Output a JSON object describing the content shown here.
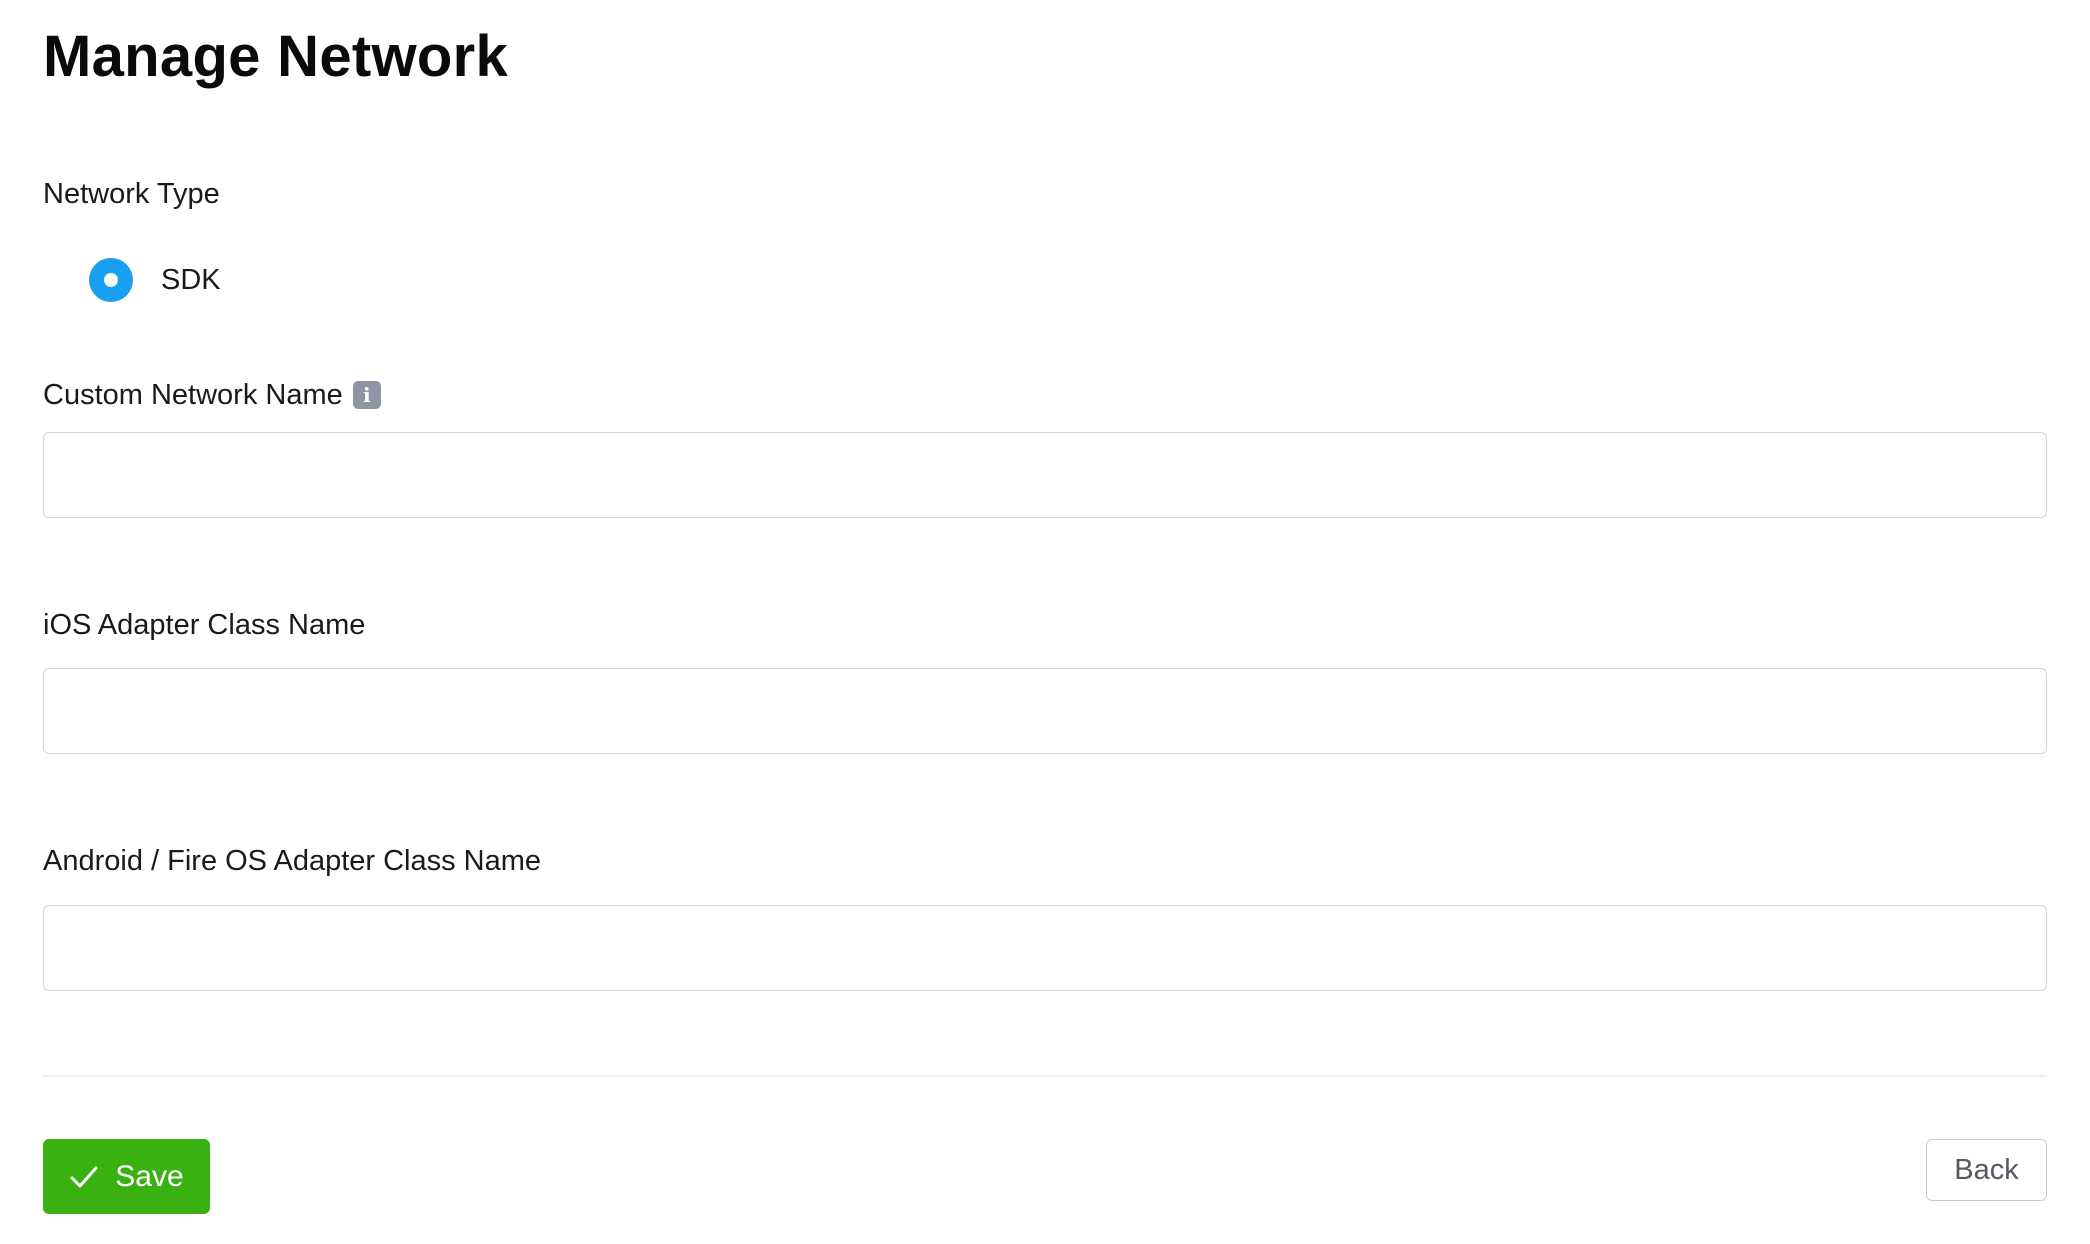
{
  "page": {
    "title": "Manage Network"
  },
  "network_type": {
    "label": "Network Type",
    "options": [
      {
        "label": "SDK",
        "selected": true
      }
    ]
  },
  "custom_network_name": {
    "label": "Custom Network Name",
    "info_icon": "info-icon",
    "value": "",
    "placeholder": ""
  },
  "ios_adapter": {
    "label": "iOS Adapter Class Name",
    "value": "",
    "placeholder": ""
  },
  "android_adapter": {
    "label": "Android / Fire OS Adapter Class Name",
    "value": "",
    "placeholder": ""
  },
  "actions": {
    "save_label": "Save",
    "save_icon": "check-icon",
    "back_label": "Back"
  },
  "colors": {
    "accent_blue": "#1a9ff0",
    "save_green": "#39b211",
    "info_gray": "#8e96a3",
    "input_border": "#d3d6da"
  }
}
